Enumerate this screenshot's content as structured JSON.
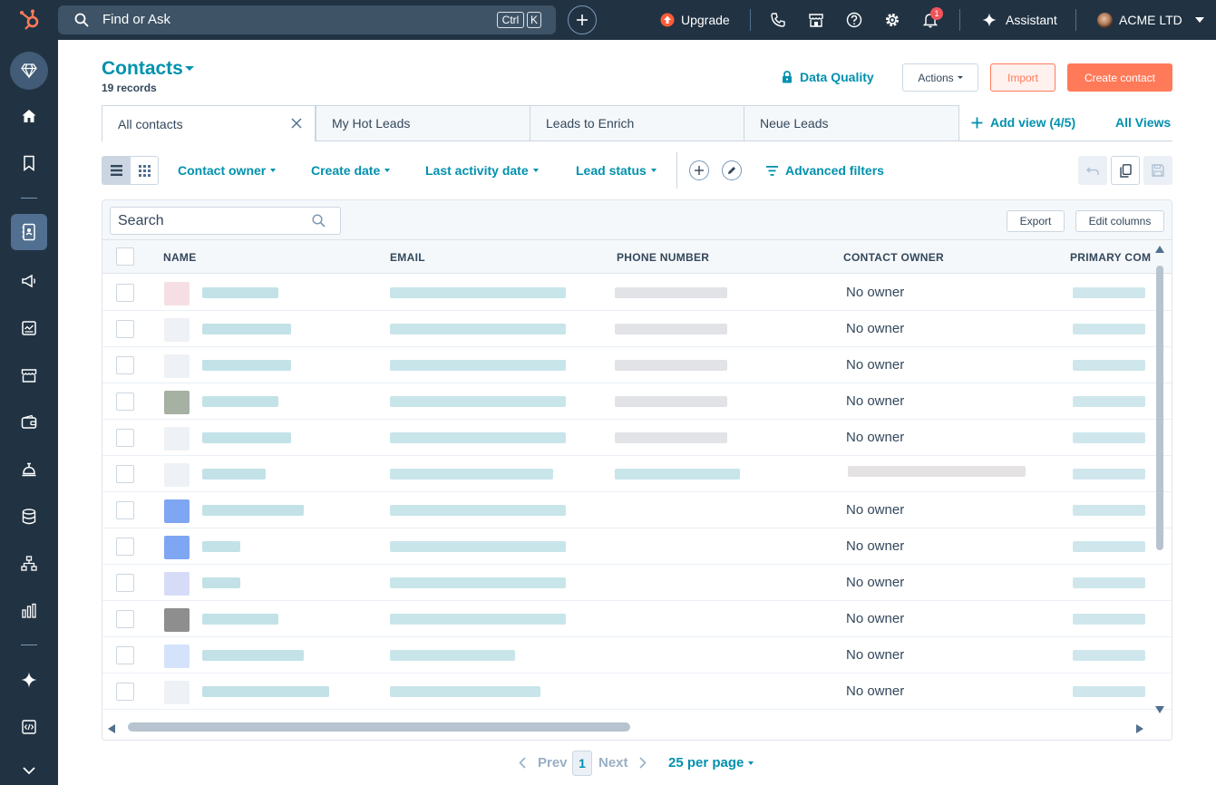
{
  "topbar": {
    "search_placeholder": "Find or Ask",
    "kbd_ctrl": "Ctrl",
    "kbd_k": "K",
    "upgrade_label": "Upgrade",
    "assistant_label": "Assistant",
    "account_name": "ACME LTD",
    "notification_count": "1",
    "brand_color": "#ff7a59"
  },
  "header": {
    "title": "Contacts",
    "record_count": "19 records",
    "data_quality": "Data Quality",
    "actions": "Actions",
    "import": "Import",
    "create": "Create contact"
  },
  "tabs": [
    "All contacts",
    "My Hot Leads",
    "Leads to Enrich",
    "Neue Leads"
  ],
  "add_view": "Add view (4/5)",
  "all_views": "All Views",
  "filters": {
    "contact_owner": "Contact owner",
    "create_date": "Create date",
    "last_activity": "Last activity date",
    "lead_status": "Lead status",
    "advanced": "Advanced filters"
  },
  "table": {
    "search_placeholder": "Search",
    "export": "Export",
    "edit_columns": "Edit columns",
    "columns": [
      "NAME",
      "EMAIL",
      "PHONE NUMBER",
      "CONTACT OWNER",
      "PRIMARY COMI"
    ],
    "owners": [
      "No owner",
      "No owner",
      "No owner",
      "No owner",
      "No owner",
      "",
      "No owner",
      "No owner",
      "No owner",
      "No owner",
      "No owner",
      "No owner"
    ]
  },
  "pagination": {
    "prev": "Prev",
    "page": "1",
    "next": "Next",
    "per_page": "25 per page"
  }
}
